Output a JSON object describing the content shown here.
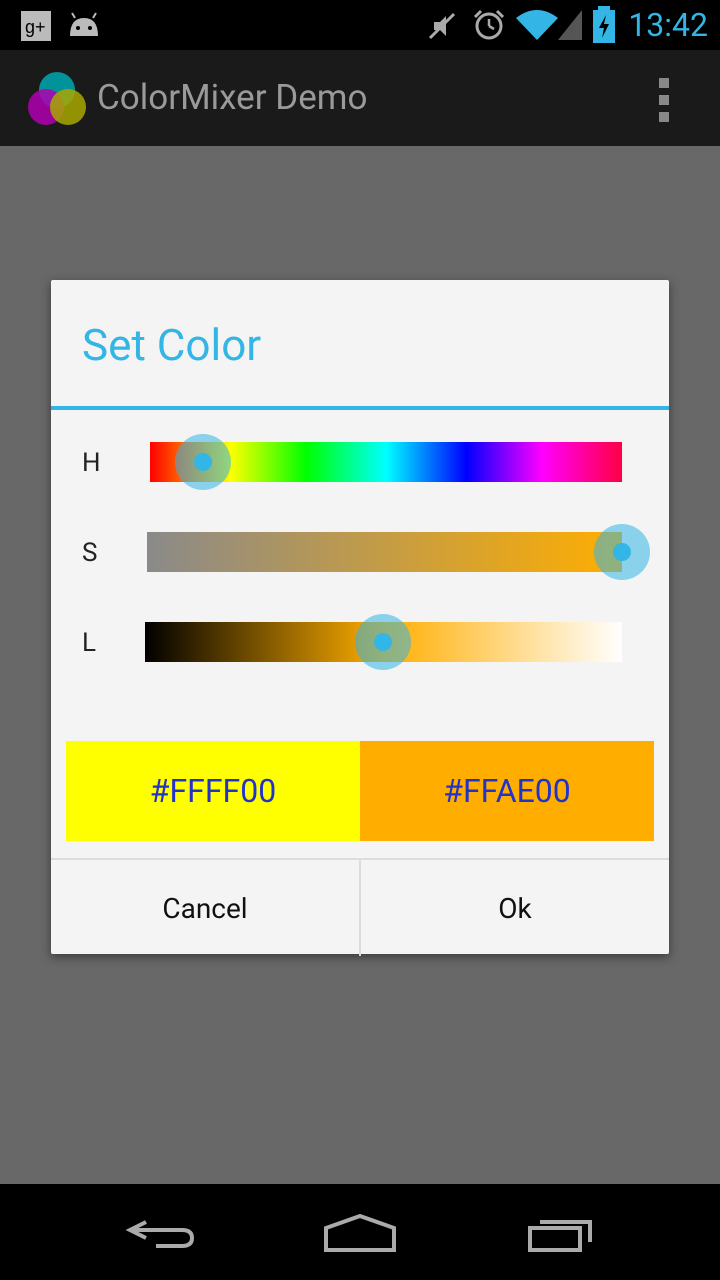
{
  "status_bar": {
    "time": "13:42",
    "icons": [
      "google-plus-icon",
      "android-icon",
      "mute-icon",
      "alarm-icon",
      "wifi-icon",
      "signal-icon",
      "battery-charging-icon"
    ]
  },
  "action_bar": {
    "title": "ColorMixer Demo",
    "icons": [
      "app-logo-icon",
      "overflow-menu-icon"
    ]
  },
  "dialog": {
    "title": "Set Color",
    "sliders": [
      {
        "label": "H",
        "value_fraction": 0.11
      },
      {
        "label": "S",
        "value_fraction": 1.0
      },
      {
        "label": "L",
        "value_fraction": 0.5
      }
    ],
    "original_color": {
      "label": "#FFFF00",
      "hex": "#FFFF00"
    },
    "new_color": {
      "label": "#FFAE00",
      "hex": "#FFAE00"
    },
    "buttons": {
      "cancel": "Cancel",
      "ok": "Ok"
    }
  },
  "nav_bar": {
    "icons": [
      "back-icon",
      "home-icon",
      "recent-apps-icon"
    ]
  },
  "colors": {
    "accent": "#33b5e5",
    "dim_background": "#686868",
    "dialog_background": "#f4f4f4"
  }
}
